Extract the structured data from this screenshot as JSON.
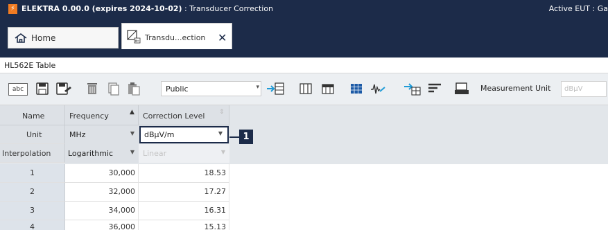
{
  "titlebar": {
    "app_icon": "lightning-icon",
    "title_app": "ELEKTRA 0.00.0 (expires 2024-10-02)",
    "title_sep": " : ",
    "title_doc": "Transducer Correction",
    "active_eut": "Active EUT : Ga"
  },
  "tabs": {
    "home_label": "Home",
    "home_icon": "house-icon",
    "transducer_label": "Transdu...ection",
    "transducer_icon": "transducer-icon",
    "close_icon": "close-icon"
  },
  "subheader": {
    "label": "HL562E Table"
  },
  "toolbar": {
    "text_button_label": "abc",
    "visibility_value": "Public",
    "measurement_unit_label": "Measurement Unit",
    "measurement_unit_value": "dBµV"
  },
  "grid": {
    "headers": {
      "name": "Name",
      "frequency": "Frequency",
      "correction": "Correction Level"
    },
    "unit_row": {
      "label": "Unit",
      "frequency_unit": "MHz",
      "correction_unit": "dBµV/m"
    },
    "interp_row": {
      "label": "Interpolation",
      "frequency_interp": "Logarithmic",
      "correction_interp": "Linear"
    },
    "rows": [
      {
        "n": "1",
        "freq": "30,000",
        "level": "18.53"
      },
      {
        "n": "2",
        "freq": "32,000",
        "level": "17.27"
      },
      {
        "n": "3",
        "freq": "34,000",
        "level": "16.31"
      },
      {
        "n": "4",
        "freq": "36,000",
        "level": "15.13"
      }
    ]
  },
  "callout": {
    "number": "1"
  },
  "colors": {
    "titlebar": "#1c2b49",
    "accent_blue": "#1f9bd7",
    "app_orange": "#f07b22",
    "highlight": "#1c2b49"
  }
}
